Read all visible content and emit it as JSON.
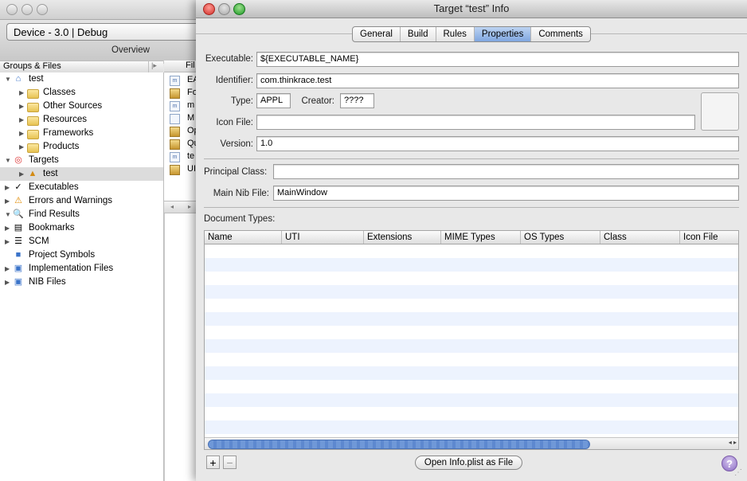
{
  "back_window": {
    "device_popup": "Device - 3.0 | Debug",
    "overview_label": "Overview",
    "groups_header": "Groups & Files",
    "files_header": "Fil",
    "tree": [
      {
        "label": "test",
        "icon": "project-icon",
        "indent": 0,
        "disclosure": "open",
        "icon_glyph": "⌂"
      },
      {
        "label": "Classes",
        "icon": "folder-icon",
        "indent": 1,
        "disclosure": "closed"
      },
      {
        "label": "Other Sources",
        "icon": "folder-icon",
        "indent": 1,
        "disclosure": "closed"
      },
      {
        "label": "Resources",
        "icon": "folder-icon",
        "indent": 1,
        "disclosure": "closed"
      },
      {
        "label": "Frameworks",
        "icon": "folder-icon",
        "indent": 1,
        "disclosure": "closed"
      },
      {
        "label": "Products",
        "icon": "folder-icon",
        "indent": 1,
        "disclosure": "closed"
      },
      {
        "label": "Targets",
        "icon": "target-icon",
        "indent": 0,
        "disclosure": "open",
        "icon_glyph": "◎"
      },
      {
        "label": "test",
        "icon": "app-target-icon",
        "indent": 1,
        "disclosure": "closed",
        "selected": true,
        "icon_glyph": "▲"
      },
      {
        "label": "Executables",
        "icon": "executables-icon",
        "indent": 0,
        "disclosure": "closed",
        "icon_glyph": "✓"
      },
      {
        "label": "Errors and Warnings",
        "icon": "warning-icon",
        "indent": 0,
        "disclosure": "closed",
        "icon_glyph": "⚠"
      },
      {
        "label": "Find Results",
        "icon": "magnifier-icon",
        "indent": 0,
        "disclosure": "open",
        "icon_glyph": "🔍"
      },
      {
        "label": "Bookmarks",
        "icon": "bookmarks-icon",
        "indent": 0,
        "disclosure": "closed",
        "icon_glyph": "▤"
      },
      {
        "label": "SCM",
        "icon": "scm-icon",
        "indent": 0,
        "disclosure": "closed",
        "icon_glyph": "☰"
      },
      {
        "label": "Project Symbols",
        "icon": "symbols-icon",
        "indent": 0,
        "disclosure": "none",
        "icon_glyph": "■"
      },
      {
        "label": "Implementation Files",
        "icon": "smart-group-icon",
        "indent": 0,
        "disclosure": "closed",
        "icon_glyph": "▣"
      },
      {
        "label": "NIB Files",
        "icon": "smart-group-icon",
        "indent": 0,
        "disclosure": "closed",
        "icon_glyph": "▣"
      }
    ],
    "files": [
      {
        "text": "EA",
        "kind": "m"
      },
      {
        "text": "Fo",
        "kind": "pkg"
      },
      {
        "text": "m",
        "kind": "m"
      },
      {
        "text": "M",
        "kind": "doc"
      },
      {
        "text": "Op",
        "kind": "pkg"
      },
      {
        "text": "Qu",
        "kind": "pkg"
      },
      {
        "text": "te",
        "kind": "m"
      },
      {
        "text": "UI",
        "kind": "pkg"
      }
    ]
  },
  "info_window": {
    "title": "Target “test” Info",
    "tabs": [
      {
        "label": "General",
        "active": false
      },
      {
        "label": "Build",
        "active": false
      },
      {
        "label": "Rules",
        "active": false
      },
      {
        "label": "Properties",
        "active": true
      },
      {
        "label": "Comments",
        "active": false
      }
    ],
    "properties": {
      "executable_label": "Executable:",
      "executable_value": "${EXECUTABLE_NAME}",
      "identifier_label": "Identifier:",
      "identifier_value": "com.thinkrace.test",
      "type_label": "Type:",
      "type_value": "APPL",
      "creator_label": "Creator:",
      "creator_value": "????",
      "icon_file_label": "Icon File:",
      "icon_file_value": "",
      "version_label": "Version:",
      "version_value": "1.0",
      "principal_class_label": "Principal Class:",
      "principal_class_value": "",
      "main_nib_label": "Main Nib File:",
      "main_nib_value": "MainWindow",
      "document_types_label": "Document Types:"
    },
    "document_types_columns": [
      "Name",
      "UTI",
      "Extensions",
      "MIME Types",
      "OS Types",
      "Class",
      "Icon File"
    ],
    "document_types_rows": [],
    "add_button": "+",
    "remove_button": "−",
    "open_plist_button": "Open Info.plist as File",
    "help_button": "?"
  },
  "colors": {
    "close": "#e0443e",
    "minimize": "#dea123",
    "zoom": "#1aab29",
    "selection": "#7fa6e0",
    "stripe": "#edf3fe"
  }
}
